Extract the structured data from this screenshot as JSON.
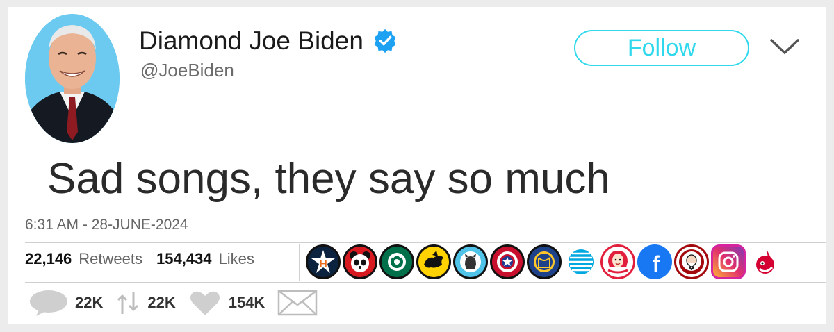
{
  "user": {
    "display_name": "Diamond Joe Biden",
    "handle": "@JoeBiden",
    "verified": true
  },
  "follow_button": {
    "label": "Follow"
  },
  "tweet": {
    "text": "Sad songs, they say so much",
    "timestamp": "6:31 AM - 28-JUNE-2024"
  },
  "stats": {
    "retweets_count": "22,146",
    "retweets_label": "Retweets",
    "likes_count": "154,434",
    "likes_label": "Likes"
  },
  "likers": [
    {
      "icon": "astros-logo-icon"
    },
    {
      "icon": "panda-logo-icon"
    },
    {
      "icon": "starbucks-logo-icon"
    },
    {
      "icon": "buffalo-wild-wings-logo-icon"
    },
    {
      "icon": "github-octocat-icon"
    },
    {
      "icon": "captain-america-shield-icon"
    },
    {
      "icon": "golden-state-warriors-logo-icon"
    },
    {
      "icon": "att-globe-logo-icon"
    },
    {
      "icon": "wendys-logo-icon"
    },
    {
      "icon": "facebook-logo-icon"
    },
    {
      "icon": "kfc-logo-icon"
    },
    {
      "icon": "instagram-logo-icon"
    },
    {
      "icon": "chief-wahoo-logo-icon"
    }
  ],
  "actions": {
    "reply_count": "22K",
    "retweet_count": "22K",
    "like_count": "154K"
  },
  "colors": {
    "accent": "#2fd8ec",
    "verified": "#1da1f2",
    "avatar_bg": "#6ccaf0"
  }
}
